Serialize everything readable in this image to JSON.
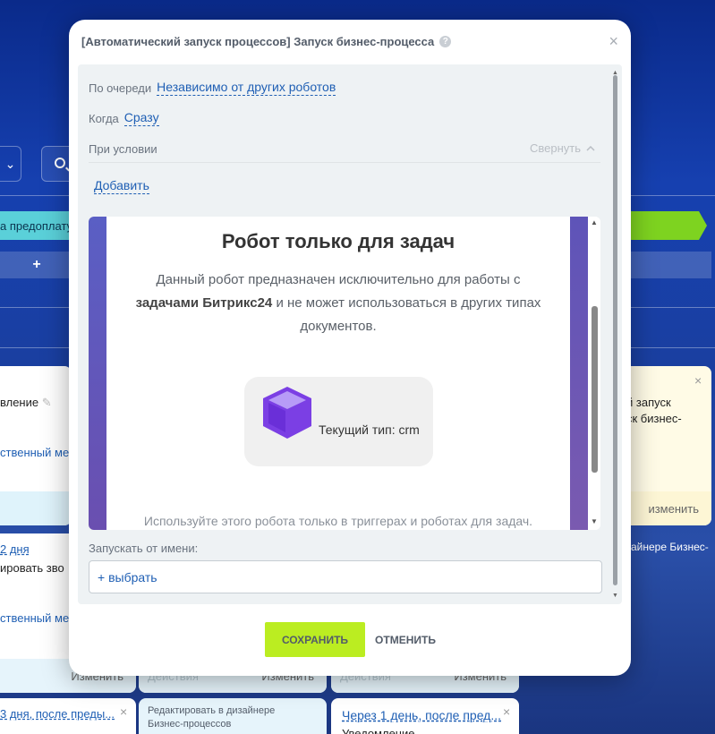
{
  "background": {
    "stage_left_label": "а предоплату",
    "add_symbol": "+",
    "card_left_1": {
      "text": "вление",
      "link": "ственный мен",
      "pencil": "✎"
    },
    "card_left_2": {
      "date_link": "2 дня",
      "text": "ировать зво",
      "link": "ственный мен",
      "foot_button": "Изменить"
    },
    "card_right_1": {
      "line1": "й запуск",
      "line2": "ск бизнес-",
      "close": "×",
      "foot_button": "изменить"
    },
    "card_right_2": {
      "text": "айнере Бизнес-"
    },
    "card_mid_foot": {
      "actions": "Действия",
      "button": "Изменить"
    },
    "card_mid2_foot": {
      "actions": "Действия",
      "button": "Изменить"
    },
    "bottom_cards": [
      {
        "link": "3 дня, после преды...",
        "close": "×"
      },
      {
        "text": "Редактировать в дизайнере Бизнес-процессов"
      },
      {
        "link": "Через 1 день, после пред...",
        "close": "×",
        "sub": "Уведомление"
      }
    ]
  },
  "modal": {
    "title": "[Автоматический запуск процессов] Запуск бизнес-процесса",
    "help_symbol": "?",
    "close_symbol": "×",
    "order": {
      "label": "По очереди",
      "value": "Независимо от других роботов"
    },
    "when": {
      "label": "Когда",
      "value": "Сразу"
    },
    "condition": {
      "label": "При условии",
      "collapse": "Свернуть",
      "add": "Добавить"
    },
    "robot": {
      "title": "Робот только для задач",
      "desc_part1": "Данный робот предназначен исключительно для работы с ",
      "desc_bold": "задачами Битрикс24",
      "desc_part2": " и не может использоваться в других типах документов.",
      "current_type": "Текущий тип: crm",
      "footer": "Используйте этого робота только в триггерах и роботах для задач."
    },
    "run_as": {
      "label": "Запускать от имени:",
      "value": "+ выбрать"
    },
    "buttons": {
      "save": "СОХРАНИТЬ",
      "cancel": "ОТМЕНИТЬ"
    }
  },
  "colors": {
    "save_button": "#bbed21",
    "link": "#1f5fb4",
    "cube": "#7b3fe4",
    "stage_cyan": "#5ad0d9",
    "stage_green": "#7ed320"
  }
}
